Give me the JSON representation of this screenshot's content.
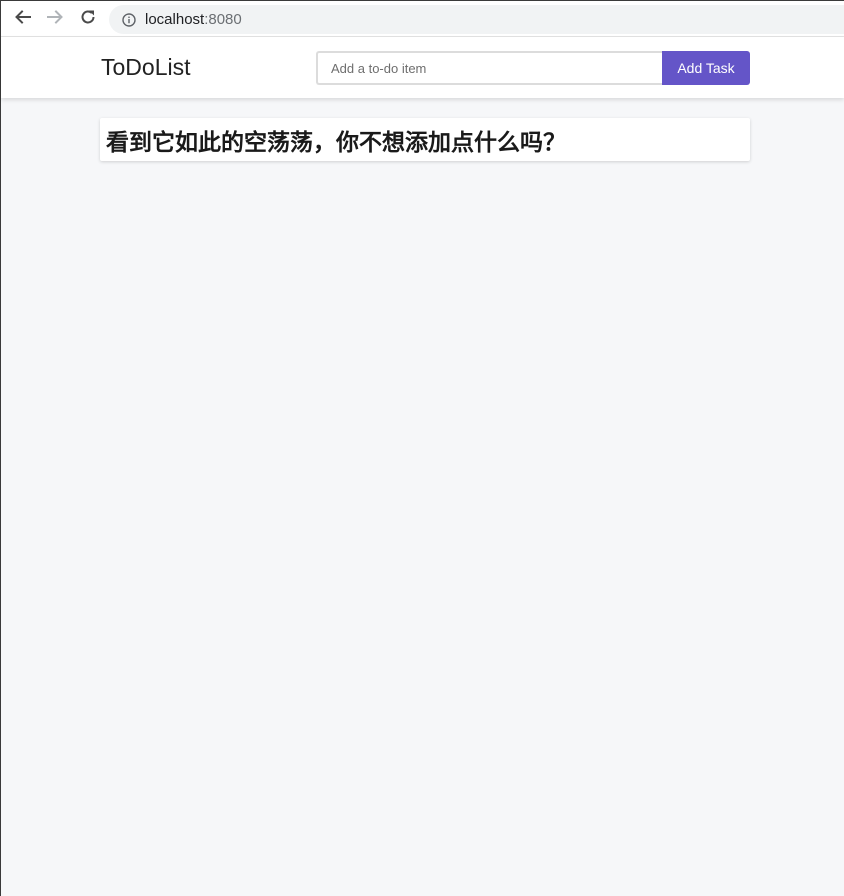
{
  "browser": {
    "url_host": "localhost",
    "url_port": ":8080",
    "icons": {
      "back": "arrow-left-icon",
      "forward": "arrow-right-icon",
      "reload": "reload-icon",
      "site_info": "info-icon"
    }
  },
  "header": {
    "brand": "ToDoList",
    "input_placeholder": "Add a to-do item",
    "input_value": "",
    "add_button_label": "Add Task",
    "accent_color": "#6455c8"
  },
  "main": {
    "empty_message": "看到它如此的空荡荡，你不想添加点什么吗？"
  }
}
